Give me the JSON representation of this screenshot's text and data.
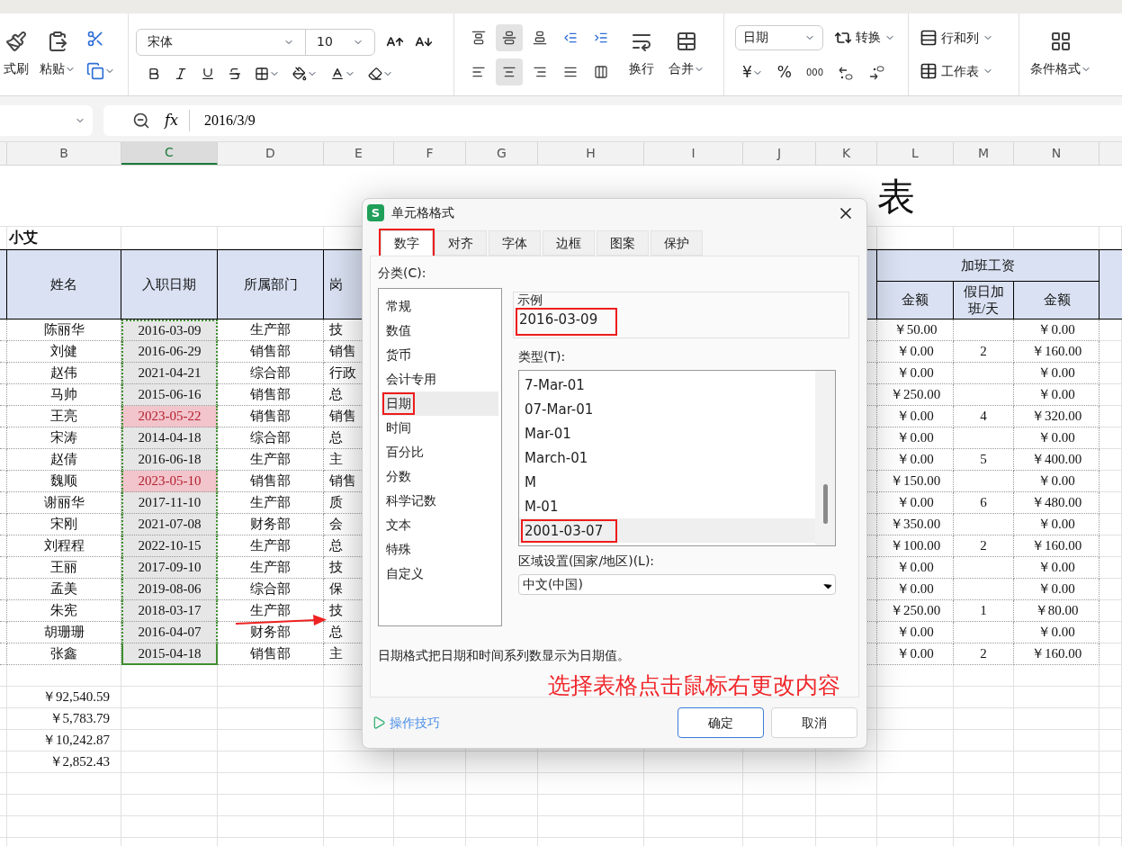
{
  "ribbon": {
    "format_painter": "式刷",
    "paste": "粘贴",
    "font_name": "宋体",
    "font_size": "10",
    "align_rows": [
      [
        {
          "kind": "top",
          "selected": false
        },
        {
          "kind": "middle",
          "selected": true
        },
        {
          "kind": "bottom",
          "selected": false
        },
        {
          "kind": "outdent",
          "selected": false
        },
        {
          "kind": "indent",
          "selected": false
        }
      ],
      [
        {
          "kind": "left",
          "selected": false
        },
        {
          "kind": "center",
          "selected": true
        },
        {
          "kind": "right",
          "selected": false
        },
        {
          "kind": "justify",
          "selected": false
        },
        {
          "kind": "distribute",
          "selected": false
        }
      ]
    ],
    "wrap": "换行",
    "merge": "合并",
    "number_format": "日期",
    "convert": "转换",
    "currency": "¥",
    "percent": "%",
    "thousands": "000",
    "rows_cols": "行和列",
    "worksheet": "工作表",
    "conditional_format": "条件格式"
  },
  "formula_bar": {
    "function_label": "fx",
    "value": "2016/3/9"
  },
  "sheet": {
    "columns": [
      {
        "label": "B",
        "selected": false
      },
      {
        "label": "C",
        "selected": true
      },
      {
        "label": "D",
        "selected": false
      },
      {
        "label": "E",
        "selected": false
      },
      {
        "label": "F",
        "selected": false
      },
      {
        "label": "G",
        "selected": false
      },
      {
        "label": "H",
        "selected": false
      },
      {
        "label": "I",
        "selected": false
      },
      {
        "label": "J",
        "selected": false
      },
      {
        "label": "K",
        "selected": false
      },
      {
        "label": "L",
        "selected": false
      },
      {
        "label": "M",
        "selected": false
      },
      {
        "label": "N",
        "selected": false
      }
    ],
    "title": "表",
    "owner": "小艾",
    "headers": {
      "name": "姓名",
      "date": "入职日期",
      "dept": "所属部门",
      "position": "岗",
      "overtime_group": "加班工资",
      "amount_1": "金额",
      "holiday_days": "假日加班/天",
      "amount_2": "金额"
    },
    "rows": [
      {
        "name": "陈丽华",
        "date": "2016-03-09",
        "date_selected": true,
        "date_flagged": false,
        "dept": "生产部",
        "position": "技",
        "amount_1": "￥50.00",
        "amount_2": "￥0.00"
      },
      {
        "name": "刘健",
        "date": "2016-06-29",
        "date_selected": true,
        "date_flagged": false,
        "dept": "销售部",
        "position": "销售",
        "amount_1": "￥0.00",
        "holiday_days": "2",
        "amount_2": "￥160.00"
      },
      {
        "name": "赵伟",
        "date": "2021-04-21",
        "date_selected": true,
        "date_flagged": false,
        "dept": "综合部",
        "position": "行政",
        "amount_1": "￥0.00",
        "amount_2": "￥0.00"
      },
      {
        "name": "马帅",
        "date": "2015-06-16",
        "date_selected": true,
        "date_flagged": false,
        "dept": "销售部",
        "position": "总",
        "amount_1": "￥250.00",
        "amount_2": "￥0.00"
      },
      {
        "name": "王亮",
        "date": "2023-05-22",
        "date_selected": true,
        "date_flagged": true,
        "dept": "销售部",
        "position": "销售",
        "amount_1": "￥0.00",
        "holiday_days": "4",
        "amount_2": "￥320.00"
      },
      {
        "name": "宋涛",
        "date": "2014-04-18",
        "date_selected": true,
        "date_flagged": false,
        "dept": "综合部",
        "position": "总",
        "amount_1": "￥0.00",
        "amount_2": "￥0.00"
      },
      {
        "name": "赵倩",
        "date": "2016-06-18",
        "date_selected": true,
        "date_flagged": false,
        "dept": "生产部",
        "position": "主",
        "amount_1": "￥0.00",
        "holiday_days": "5",
        "amount_2": "￥400.00"
      },
      {
        "name": "魏顺",
        "date": "2023-05-10",
        "date_selected": true,
        "date_flagged": true,
        "dept": "销售部",
        "position": "销售",
        "amount_1": "￥150.00",
        "amount_2": "￥0.00"
      },
      {
        "name": "谢丽华",
        "date": "2017-11-10",
        "date_selected": true,
        "date_flagged": false,
        "dept": "生产部",
        "position": "质",
        "amount_1": "￥0.00",
        "holiday_days": "6",
        "amount_2": "￥480.00"
      },
      {
        "name": "宋刚",
        "date": "2021-07-08",
        "date_selected": true,
        "date_flagged": false,
        "dept": "财务部",
        "position": "会",
        "amount_1": "￥350.00",
        "amount_2": "￥0.00"
      },
      {
        "name": "刘程程",
        "date": "2022-10-15",
        "date_selected": true,
        "date_flagged": false,
        "dept": "生产部",
        "position": "总",
        "amount_1": "￥100.00",
        "holiday_days": "2",
        "amount_2": "￥160.00"
      },
      {
        "name": "王丽",
        "date": "2017-09-10",
        "date_selected": true,
        "date_flagged": false,
        "dept": "生产部",
        "position": "技",
        "amount_1": "￥0.00",
        "amount_2": "￥0.00"
      },
      {
        "name": "孟美",
        "date": "2019-08-06",
        "date_selected": true,
        "date_flagged": false,
        "dept": "综合部",
        "position": "保",
        "amount_1": "￥0.00",
        "amount_2": "￥0.00"
      },
      {
        "name": "朱宪",
        "date": "2018-03-17",
        "date_selected": true,
        "date_flagged": false,
        "dept": "生产部",
        "position": "技",
        "amount_1": "￥250.00",
        "holiday_days": "1",
        "amount_2": "￥80.00"
      },
      {
        "name": "胡珊珊",
        "date": "2016-04-07",
        "date_selected": true,
        "date_flagged": false,
        "dept": "财务部",
        "position": "总",
        "amount_1": "￥0.00",
        "amount_2": "￥0.00"
      },
      {
        "name": "张鑫",
        "date": "2015-04-18",
        "date_selected": true,
        "date_flagged": false,
        "dept": "销售部",
        "position": "主",
        "amount_1": "￥0.00",
        "holiday_days": "2",
        "amount_2": "￥160.00"
      }
    ],
    "totals": [
      "￥92,540.59",
      "￥5,783.79",
      "￥10,242.87",
      "￥2,852.43"
    ]
  },
  "dialog": {
    "app_logo": "S",
    "title": "单元格格式",
    "tabs": [
      {
        "label": "数字",
        "selected": true,
        "annotated": true
      },
      {
        "label": "对齐",
        "selected": false,
        "annotated": false
      },
      {
        "label": "字体",
        "selected": false,
        "annotated": false
      },
      {
        "label": "边框",
        "selected": false,
        "annotated": false
      },
      {
        "label": "图案",
        "selected": false,
        "annotated": false
      },
      {
        "label": "保护",
        "selected": false,
        "annotated": false
      }
    ],
    "category_label": "分类(C):",
    "categories": [
      {
        "label": "常规",
        "selected": false,
        "annotated": false
      },
      {
        "label": "数值",
        "selected": false,
        "annotated": false
      },
      {
        "label": "货币",
        "selected": false,
        "annotated": false
      },
      {
        "label": "会计专用",
        "selected": false,
        "annotated": false
      },
      {
        "label": "日期",
        "selected": true,
        "annotated": true
      },
      {
        "label": "时间",
        "selected": false,
        "annotated": false
      },
      {
        "label": "百分比",
        "selected": false,
        "annotated": false
      },
      {
        "label": "分数",
        "selected": false,
        "annotated": false
      },
      {
        "label": "科学记数",
        "selected": false,
        "annotated": false
      },
      {
        "label": "文本",
        "selected": false,
        "annotated": false
      },
      {
        "label": "特殊",
        "selected": false,
        "annotated": false
      },
      {
        "label": "自定义",
        "selected": false,
        "annotated": false
      }
    ],
    "sample": {
      "label": "示例",
      "value": "2016-03-09",
      "annotated": true
    },
    "type_label": "类型(T):",
    "types": [
      {
        "label": "7-Mar-01",
        "selected": false,
        "annotated": false
      },
      {
        "label": "07-Mar-01",
        "selected": false,
        "annotated": false
      },
      {
        "label": "Mar-01",
        "selected": false,
        "annotated": false
      },
      {
        "label": "March-01",
        "selected": false,
        "annotated": false
      },
      {
        "label": "M",
        "selected": false,
        "annotated": false
      },
      {
        "label": "M-01",
        "selected": false,
        "annotated": false
      },
      {
        "label": "2001-03-07",
        "selected": true,
        "annotated": true
      }
    ],
    "locale_label": "区域设置(国家/地区)(L):",
    "locale": "中文(中国)",
    "description": "日期格式把日期和时间系列数显示为日期值。",
    "note": "选择表格点击鼠标右更改内容",
    "tips": "操作技巧",
    "ok": "确定",
    "cancel": "取消"
  }
}
